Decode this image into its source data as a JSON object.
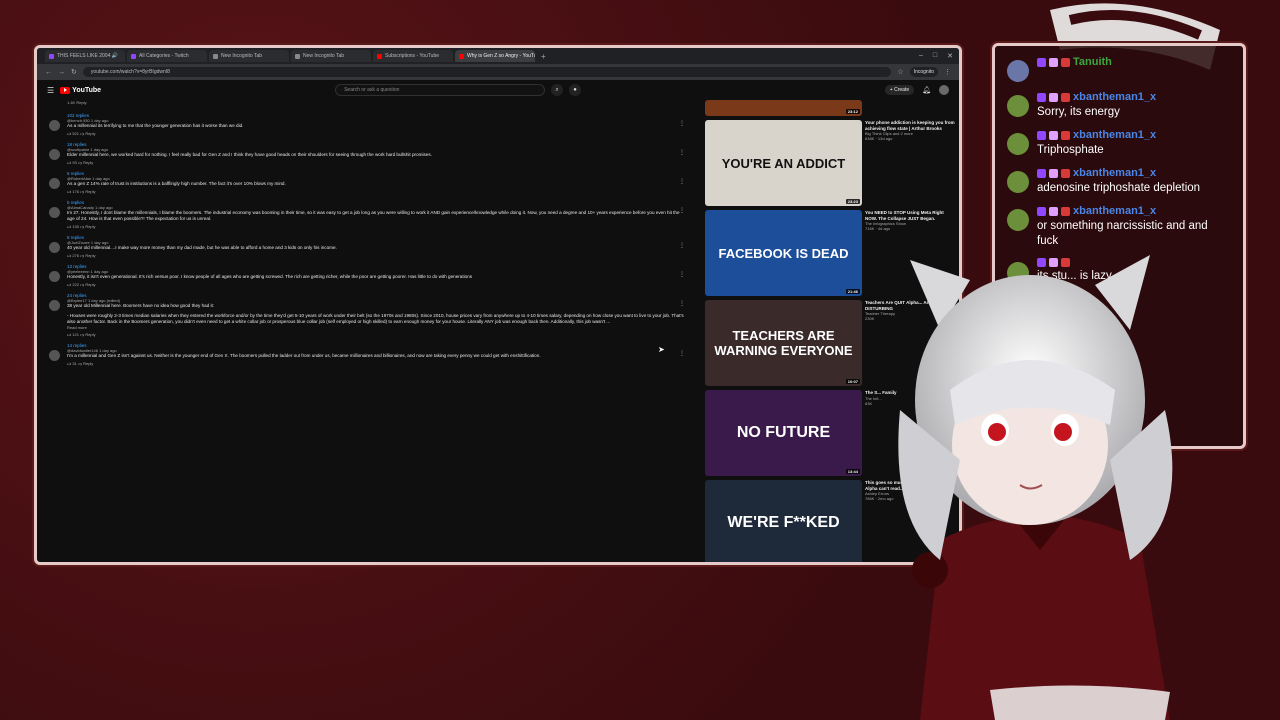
{
  "browser": {
    "tabs": [
      {
        "label": "THIS FEELS LIKE 2004 🔊",
        "color": "#9146ff"
      },
      {
        "label": "All Categories - Twitch",
        "color": "#9146ff"
      },
      {
        "label": "New Incognito Tab",
        "color": "#888888"
      },
      {
        "label": "New Incognito Tab",
        "color": "#888888"
      },
      {
        "label": "Subscriptions - YouTube",
        "color": "#ff0000"
      },
      {
        "label": "Why is Gen Z so Angry - YouTu",
        "color": "#ff0000",
        "active": true
      }
    ],
    "url": "youtube.com/watch?v=8yrBIgdwnI8",
    "incognito_label": "Incognito"
  },
  "youtube": {
    "logo_text": "YouTube",
    "search_placeholder": "Search or ask a question",
    "create_label": "+ Create"
  },
  "comments": {
    "top_actions": "1.4K   Reply",
    "items": [
      {
        "replies": "102 replies",
        "user": "@bench.930  1 day ago",
        "text": "As a millennial its terrifying to me that the younger generation has it worse than we did.",
        "likes": "521"
      },
      {
        "replies": "18 replies",
        "user": "@scottpaine  1 day ago",
        "text": "Elder millennial here, we worked hard for nothing. I feel really bad for Gen Z and I think they have good heads on their shoulders for seeing through the work hard bullshit promises.",
        "likes": "93"
      },
      {
        "replies": "6 replies",
        "user": "@RobertAlan  1 day ago",
        "text": "As a gen Z 14% rate of trust in institutions is a bafflingly high number. The fact it's over 10% blows my mind.",
        "likes": "176"
      },
      {
        "replies": "5 replies",
        "user": "@AlmaCanady  1 day ago",
        "text": "Im 27. Honestly, I dont blame the millennials, I blame the boomers. The industrial economy was booming in their time, so it was easy to get a job long as you were willing to work it AND gain experience/knowledge while doing it. Now, you need a degree and 10+ years experience before you even hit the age of 24. How is that even possible?! The expectation for us is unreal.",
        "likes": "130"
      },
      {
        "replies": "8 replies",
        "user": "@JoelZooee  1 day ago",
        "text": "40 year old millennial....I make way more money than my dad made, but he was able to afford a home and 3 kids on only his income.",
        "likes": "276"
      },
      {
        "replies": "13 replies",
        "user": "@yeeleeenn  1 day ago",
        "text": "Honestly, it isn't even generational. It's rich versus poor. I know people of all ages who are getting screwed. The rich are getting richer, while the poor are getting poorer. Has little to do with generations",
        "likes": "222"
      },
      {
        "replies": "24 replies",
        "user": "@Brylee17  1 day ago (edited)",
        "text": "38 year old Millennial here. Boomers have no idea how good they had it:",
        "text2": "- Houses were roughly 2-3 times median salaries when they entered the workforce and/or by the time they'd get 5-10 years of work under their belt (so the 1970s and 1980s). Since 2010, house prices vary from anywhere up to 4-10 times salary, depending on how close you want to live to your job. That's also another factor. Back in the Boomers generation, you didn't even need to get a white collar job or prosperous blue collar job (self employed or high skilled) to earn enough money for your house. Literally ANY job was enough back then. Additionally, this job wasn't ...",
        "more": "Read more",
        "likes": "121"
      },
      {
        "replies": "14 replies",
        "user": "@davidwalter146  1 day ago",
        "text": "I'm a millennial and Gen Z isn't against us. Neither is the younger end of Gen X. The boomers pulled the ladder out from under us, became millionaires and billionaires, and now are taking every penny we could get with enshittification.",
        "likes": "31"
      }
    ]
  },
  "related": [
    {
      "thumb_text": "",
      "duration": "23:12",
      "title": "",
      "channel": "",
      "bg": "#7a3a1a"
    },
    {
      "thumb_text": "YOU'RE AN ADDICT",
      "duration": "23:23",
      "title": "Your phone addiction is keeping you from achieving flow state | Arthur Brooks",
      "channel": "Big Think Clips and 2 more",
      "meta": "638K · 13d ago",
      "bg": "#d8d4cc"
    },
    {
      "thumb_text": "FACEBOOK IS DEAD",
      "duration": "21:46",
      "title": "You NEED to STOP Using Meta Right NOW. The Collapse JUST Began.",
      "channel": "The Infographics Show",
      "meta": "716K · 4d ago",
      "bg": "#1d4e9a"
    },
    {
      "thumb_text": "TEACHERS ARE WARNING EVERYONE",
      "duration": "10:07",
      "title": "Teachers Are QUIT Alpha... And That's DISTURBING",
      "channel": "Teacher Therapy",
      "meta": "230K",
      "bg": "#3a2a2a"
    },
    {
      "thumb_text": "NO FUTURE",
      "duration": "13:44",
      "title": "The S... Family",
      "channel": "The Infi...",
      "meta": "63K",
      "bg": "#3a1a4a"
    },
    {
      "thumb_text": "WE'RE F**KED",
      "duration": "",
      "title": "This goes so much deeper than Gen Alpha can't read...",
      "channel": "Ashley Errors",
      "meta": "786K · 2mo ago",
      "bg": "#1e2a3a"
    }
  ],
  "chat": [
    {
      "user": "Tanuith",
      "color": "#3ea63e",
      "text": ""
    },
    {
      "user": "xbantheman1_x",
      "color": "#4a86e8",
      "text": "Sorry, its energy"
    },
    {
      "user": "xbantheman1_x",
      "color": "#4a86e8",
      "text": "Triphosphate"
    },
    {
      "user": "xbantheman1_x",
      "color": "#4a86e8",
      "text": "adenosine triphoshate depletion"
    },
    {
      "user": "xbantheman1_x",
      "color": "#4a86e8",
      "text": "or something narcissistic and and fuck"
    },
    {
      "user": "",
      "color": "#4a86e8",
      "text": "its stu... is lazy"
    }
  ]
}
